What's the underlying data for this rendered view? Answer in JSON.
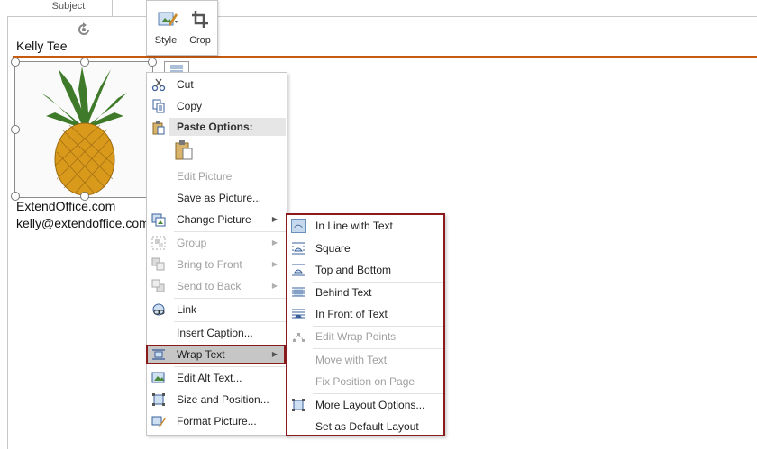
{
  "tab": {
    "subject": "Subject"
  },
  "email": {
    "author": "Kelly Tee",
    "company": "ExtendOffice.com",
    "email": "kelly@extendoffice.com"
  },
  "mini_toolbar": {
    "style": "Style",
    "crop": "Crop"
  },
  "context_menu": {
    "cut": "Cut",
    "copy": "Copy",
    "paste_options": "Paste Options:",
    "edit_picture": "Edit Picture",
    "save_as_picture": "Save as Picture...",
    "change_picture": "Change Picture",
    "group": "Group",
    "bring_to_front": "Bring to Front",
    "send_to_back": "Send to Back",
    "link": "Link",
    "insert_caption": "Insert Caption...",
    "wrap_text": "Wrap Text",
    "edit_alt_text": "Edit Alt Text...",
    "size_and_position": "Size and Position...",
    "format_picture": "Format Picture..."
  },
  "wrap_submenu": {
    "in_line": "In Line with Text",
    "square": "Square",
    "top_bottom": "Top and Bottom",
    "behind": "Behind Text",
    "in_front": "In Front of Text",
    "edit_wrap": "Edit Wrap Points",
    "move_with_text": "Move with Text",
    "fix_position": "Fix Position on Page",
    "more_layout": "More Layout Options...",
    "set_default": "Set as Default Layout"
  },
  "colors": {
    "accent": "#c55a11",
    "highlight_border": "#8b1a1a"
  }
}
